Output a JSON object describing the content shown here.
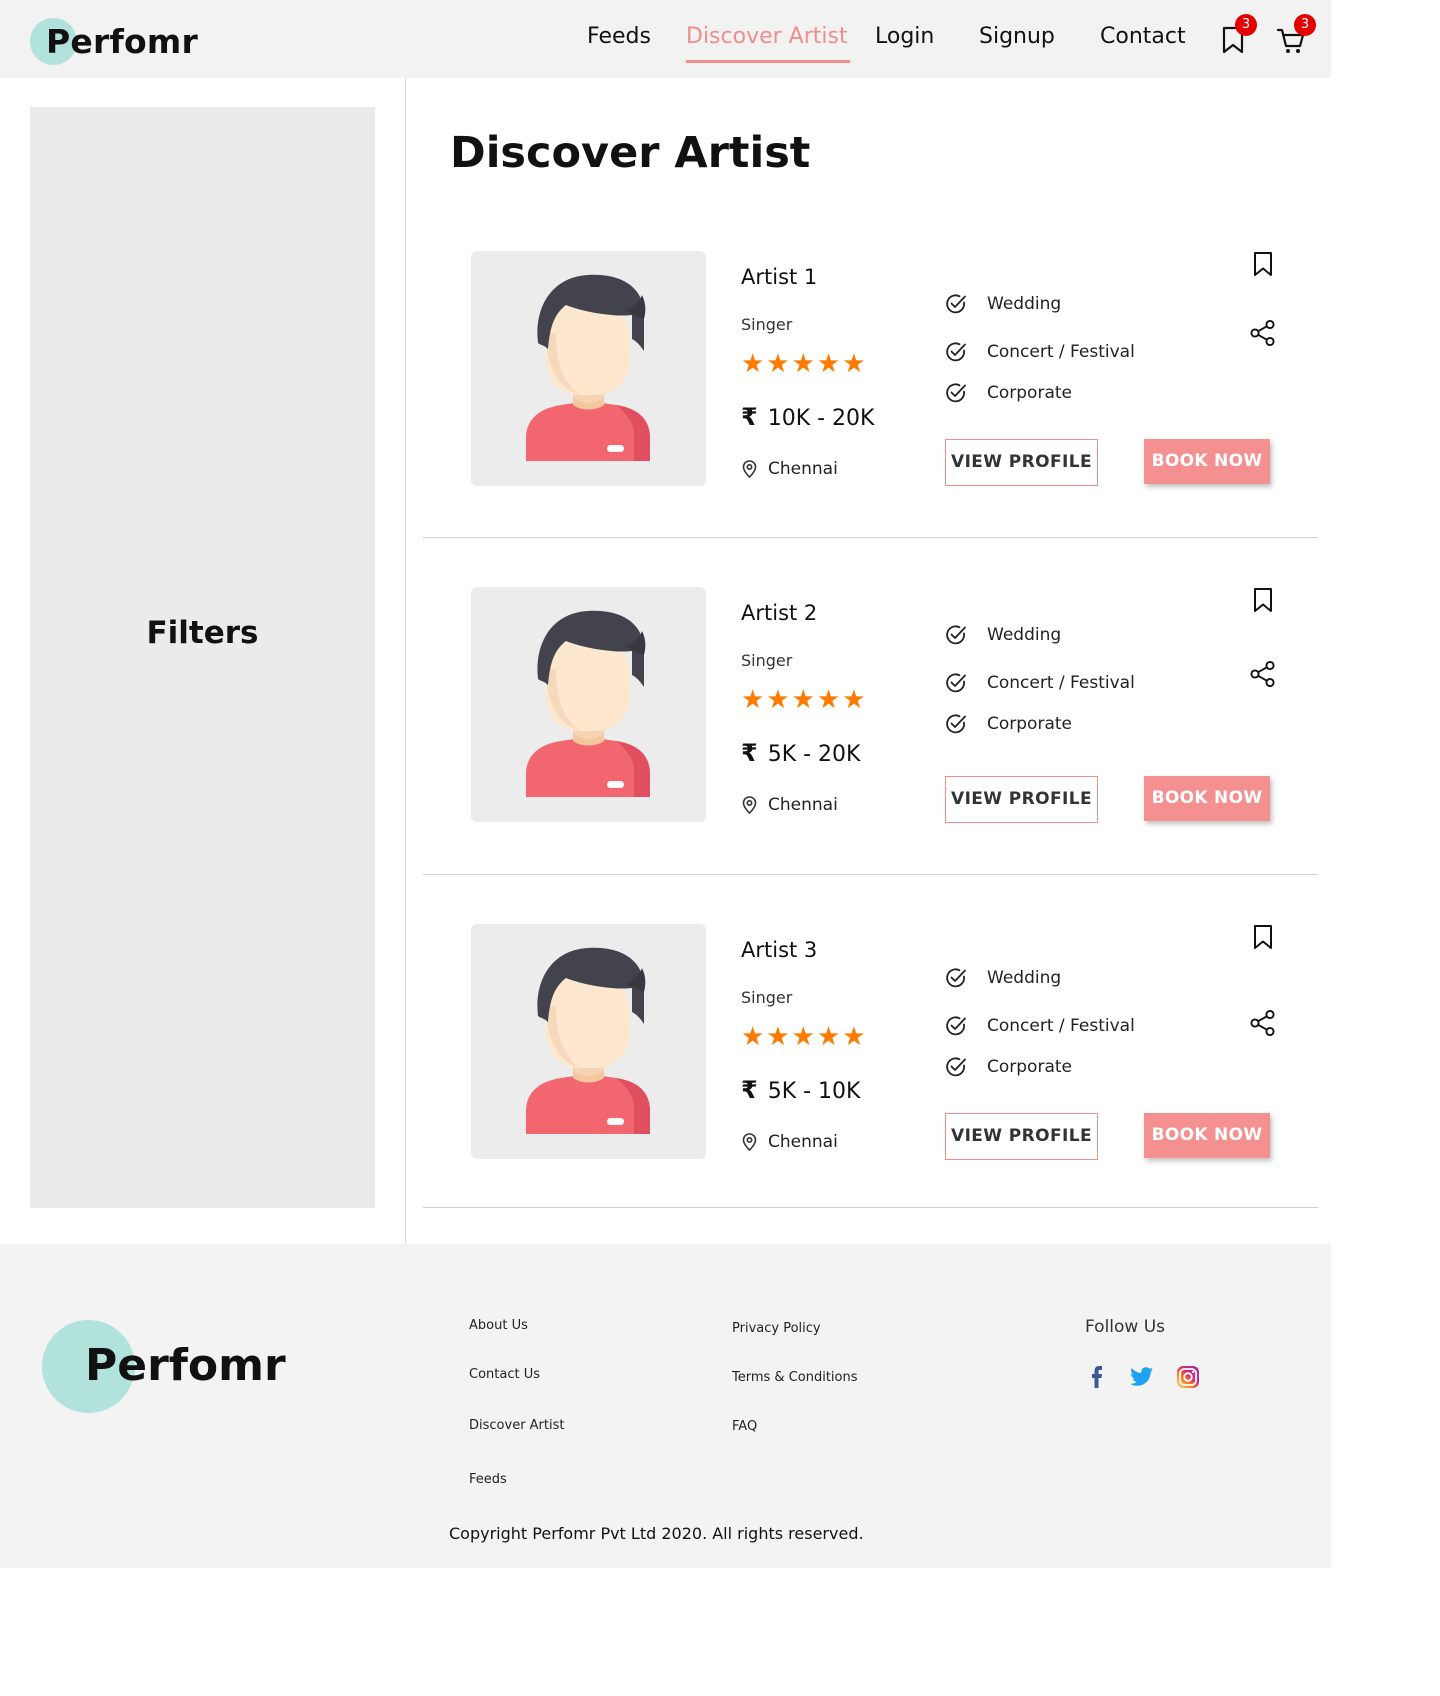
{
  "brand": {
    "name": "Perfomr",
    "accent": "#f08d8d",
    "logo_circle": "#b1e2dc"
  },
  "nav": {
    "items": [
      "Feeds",
      "Discover Artist",
      "Login",
      "Signup",
      "Contact"
    ],
    "active": "Discover Artist",
    "bookmark_count": "3",
    "cart_count": "3"
  },
  "sidebar": {
    "title": "Filters"
  },
  "main": {
    "title": "Discover Artist",
    "view_profile_label": "VIEW PROFILE",
    "book_now_label": "BOOK NOW",
    "currency_symbol": "₹",
    "artists": [
      {
        "name": "Artist 1",
        "role": "Singer",
        "rating": 5,
        "stars": "★★★★★",
        "price": "10K - 20K",
        "location": "Chennai",
        "events": [
          "Wedding",
          "Concert / Festival",
          "Corporate"
        ]
      },
      {
        "name": "Artist 2",
        "role": "Singer",
        "rating": 5,
        "stars": "★★★★★",
        "price": "5K - 20K",
        "location": "Chennai",
        "events": [
          "Wedding",
          "Concert / Festival",
          "Corporate"
        ]
      },
      {
        "name": "Artist 3",
        "role": "Singer",
        "rating": 5,
        "stars": "★★★★★",
        "price": "5K - 10K",
        "location": "Chennai",
        "events": [
          "Wedding",
          "Concert / Festival",
          "Corporate"
        ]
      }
    ]
  },
  "footer": {
    "links_col1": [
      "About Us",
      "Contact Us",
      "Discover Artist",
      "Feeds"
    ],
    "links_col2": [
      "Privacy Policy",
      "Terms & Conditions",
      "FAQ"
    ],
    "follow_title": "Follow Us",
    "social_icons": [
      "facebook-icon",
      "twitter-icon",
      "instagram-icon"
    ],
    "copyright": "Copyright Perfomr Pvt Ltd 2020. All rights reserved."
  }
}
